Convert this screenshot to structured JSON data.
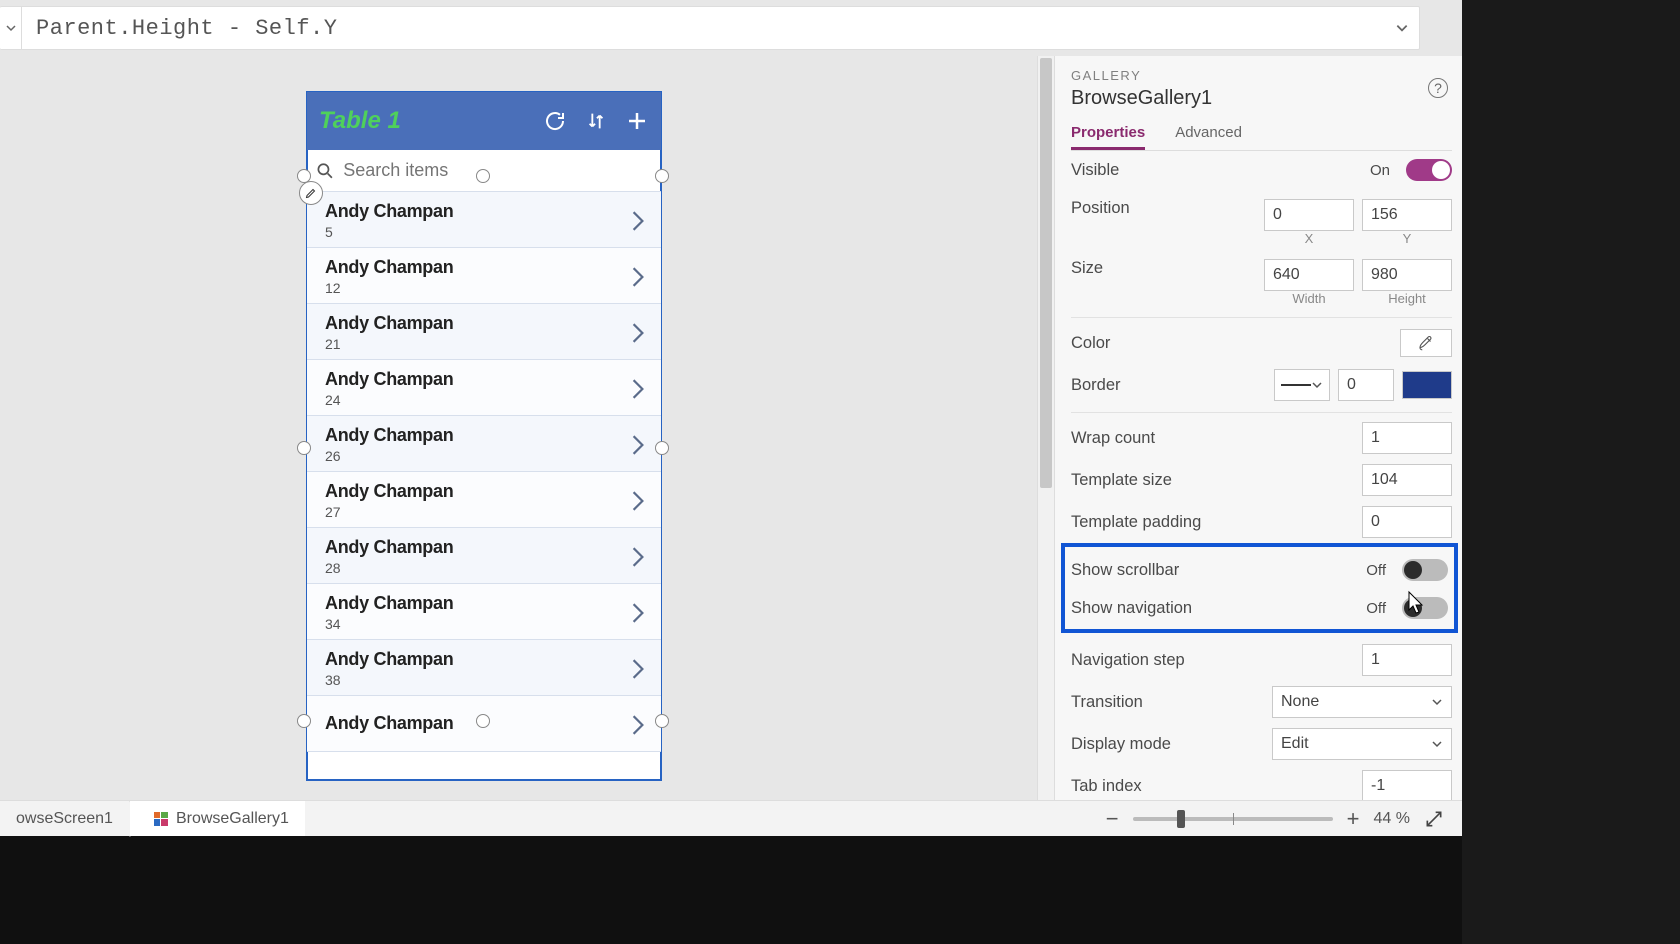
{
  "formula_bar": {
    "expression": "Parent.Height - Self.Y"
  },
  "phone_screen": {
    "title": "Table 1",
    "search_placeholder": "Search items",
    "items": [
      {
        "name": "Andy Champan",
        "sub": "5"
      },
      {
        "name": "Andy Champan",
        "sub": "12"
      },
      {
        "name": "Andy Champan",
        "sub": "21"
      },
      {
        "name": "Andy Champan",
        "sub": "24"
      },
      {
        "name": "Andy Champan",
        "sub": "26"
      },
      {
        "name": "Andy Champan",
        "sub": "27"
      },
      {
        "name": "Andy Champan",
        "sub": "28"
      },
      {
        "name": "Andy Champan",
        "sub": "34"
      },
      {
        "name": "Andy Champan",
        "sub": "38"
      },
      {
        "name": "Andy Champan",
        "sub": ""
      }
    ]
  },
  "breadcrumbs": {
    "screen": "owseScreen1",
    "control": "BrowseGallery1"
  },
  "zoom": {
    "value": "44",
    "unit": "%"
  },
  "panel": {
    "category": "GALLERY",
    "name": "BrowseGallery1",
    "tabs": {
      "properties": "Properties",
      "advanced": "Advanced"
    },
    "visible": {
      "label": "Visible",
      "state": "On"
    },
    "position": {
      "label": "Position",
      "x": "0",
      "y": "156",
      "xlabel": "X",
      "ylabel": "Y"
    },
    "size": {
      "label": "Size",
      "w": "640",
      "h": "980",
      "wlabel": "Width",
      "hlabel": "Height"
    },
    "color": {
      "label": "Color"
    },
    "border": {
      "label": "Border",
      "width": "0"
    },
    "wrap_count": {
      "label": "Wrap count",
      "value": "1"
    },
    "template_size": {
      "label": "Template size",
      "value": "104"
    },
    "template_padding": {
      "label": "Template padding",
      "value": "0"
    },
    "show_scrollbar": {
      "label": "Show scrollbar",
      "state": "Off"
    },
    "show_navigation": {
      "label": "Show navigation",
      "state": "Off"
    },
    "navigation_step": {
      "label": "Navigation step",
      "value": "1"
    },
    "transition": {
      "label": "Transition",
      "value": "None"
    },
    "display_mode": {
      "label": "Display mode",
      "value": "Edit"
    },
    "tab_index": {
      "label": "Tab index",
      "value": "-1"
    }
  }
}
